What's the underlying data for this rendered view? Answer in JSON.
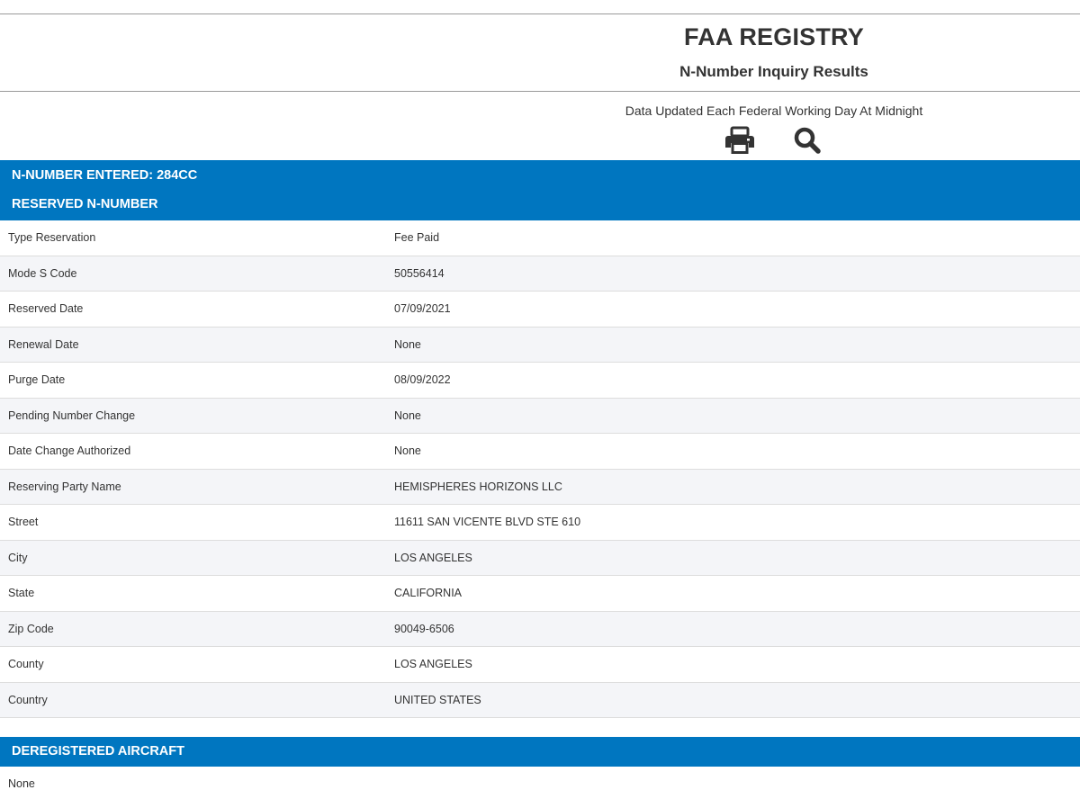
{
  "header": {
    "title": "FAA REGISTRY",
    "subtitle": "N-Number Inquiry Results",
    "update_note": "Data Updated Each Federal Working Day At Midnight"
  },
  "toolbar": {
    "print_icon": "print-icon",
    "search_icon": "search-icon"
  },
  "section_reserved": {
    "nnumber_heading": "N-NUMBER ENTERED: 284CC",
    "reserved_heading": "RESERVED N-NUMBER",
    "rows": [
      {
        "label": "Type Reservation",
        "value": "Fee Paid"
      },
      {
        "label": "Mode S Code",
        "value": "50556414"
      },
      {
        "label": "Reserved Date",
        "value": "07/09/2021"
      },
      {
        "label": "Renewal Date",
        "value": "None"
      },
      {
        "label": "Purge Date",
        "value": "08/09/2022"
      },
      {
        "label": "Pending Number Change",
        "value": "None"
      },
      {
        "label": "Date Change Authorized",
        "value": "None"
      },
      {
        "label": "Reserving Party Name",
        "value": "HEMISPHERES HORIZONS LLC"
      },
      {
        "label": "Street",
        "value": "11611 SAN VICENTE BLVD STE 610"
      },
      {
        "label": "City",
        "value": "LOS ANGELES"
      },
      {
        "label": "State",
        "value": "CALIFORNIA"
      },
      {
        "label": "Zip Code",
        "value": "90049-6506"
      },
      {
        "label": "County",
        "value": "LOS ANGELES"
      },
      {
        "label": "Country",
        "value": "UNITED STATES"
      }
    ]
  },
  "section_deregistered": {
    "heading": "DEREGISTERED AIRCRAFT",
    "value": "None"
  },
  "colors": {
    "band_blue": "#0076c0",
    "row_alt": "#f4f5f8",
    "text": "#333333"
  }
}
